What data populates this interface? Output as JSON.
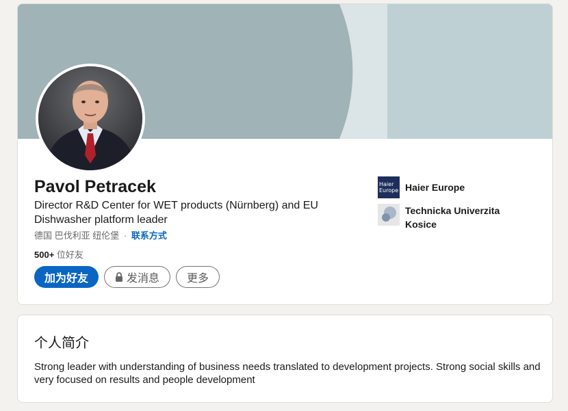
{
  "profile": {
    "name": "Pavol Petracek",
    "headline": "Director R&D Center for WET products (Nürnberg) and EU Dishwasher platform leader",
    "location": "德国 巴伐利亚 纽伦堡",
    "separator": "·",
    "contact_info_label": "联系方式",
    "connections_count": "500+",
    "connections_label": "位好友",
    "actions": {
      "connect_label": "加为好友",
      "message_label": "发消息",
      "more_label": "更多"
    },
    "organizations": [
      {
        "name": "Haier Europe",
        "logo_text_line1": "Haier",
        "logo_text_line2": "Europe"
      },
      {
        "name": "Technicka Univerzita Kosice"
      }
    ],
    "colors": {
      "accent": "#0a66c2",
      "banner_main": "#a0b3b6",
      "banner_light": "#dbe4e6",
      "banner_right": "#bed0d4"
    }
  },
  "about": {
    "title": "个人简介",
    "text": "Strong leader with understanding of business needs translated to development projects. Strong social skills and very focused on results and people development"
  },
  "icons": [
    "lock-icon",
    "haier-europe-logo",
    "technicka-univerzita-kosice-logo",
    "profile-photo"
  ]
}
